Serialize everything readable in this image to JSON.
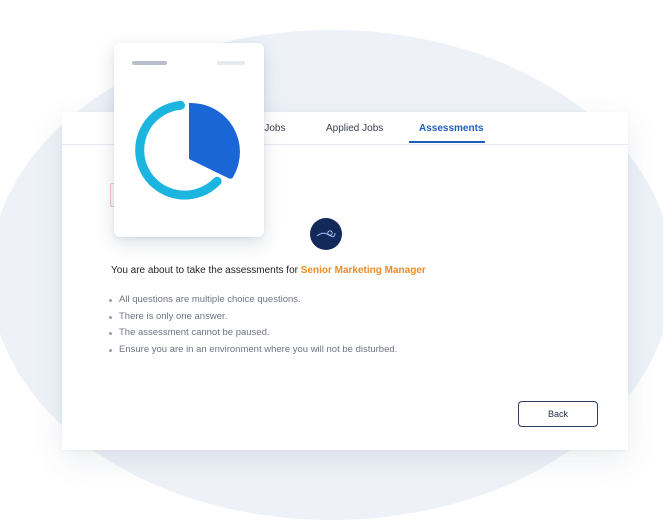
{
  "tabs": [
    {
      "label": "Applied Jobs",
      "visible_label": "d Jobs"
    },
    {
      "label": "Applied Jobs"
    },
    {
      "label": "Assessments",
      "active": true
    }
  ],
  "intro": {
    "prefix": "You are about to take the assessments for ",
    "job_title": "Senior Marketing Manager"
  },
  "rules": [
    "All questions are multiple choice questions.",
    "There is only one answer.",
    "The assessment cannot be paused.",
    "Ensure you are in an environment where you will not be disturbed."
  ],
  "buttons": {
    "back": "Back"
  },
  "icons": {
    "logo": "company-logo-icon",
    "chart": "pie-chart-icon"
  },
  "colors": {
    "accent": "#1f5fbf",
    "job_title": "#f08a24",
    "chart_ring": "#1cb5e0",
    "chart_slice": "#1a66d6",
    "logo_bg": "#13295a"
  }
}
